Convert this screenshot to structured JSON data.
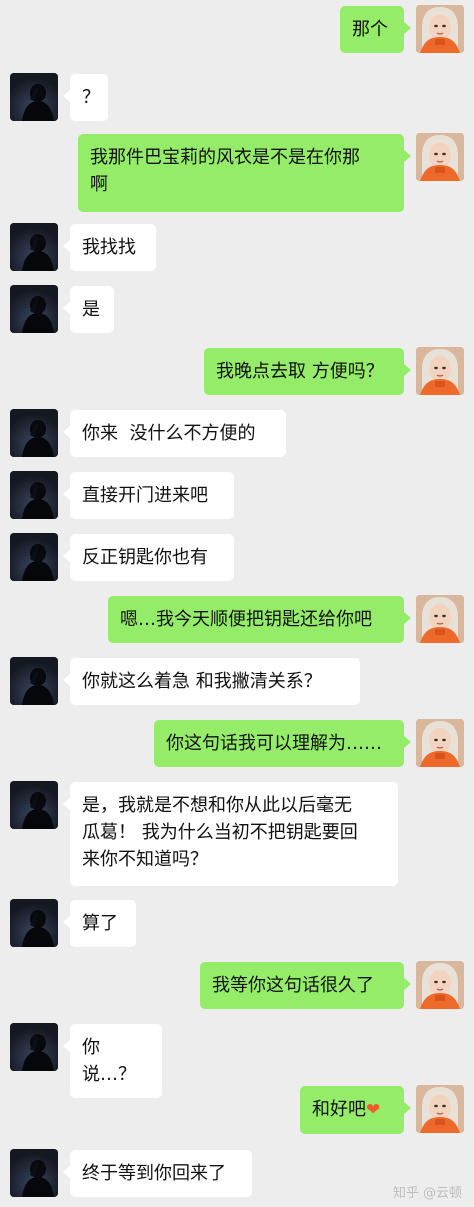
{
  "messages": [
    {
      "side": "right",
      "text": "那个"
    },
    {
      "side": "left",
      "text": "？"
    },
    {
      "side": "right",
      "text": "我那件巴宝莉的风衣是不是在你那\n啊"
    },
    {
      "side": "left",
      "text": "我找找"
    },
    {
      "side": "left",
      "text": "是"
    },
    {
      "side": "right",
      "text": "我晚点去取 方便吗？"
    },
    {
      "side": "left",
      "text": "你来  没什么不方便的"
    },
    {
      "side": "left",
      "text": "直接开门进来吧"
    },
    {
      "side": "left",
      "text": "反正钥匙你也有"
    },
    {
      "side": "right",
      "text": "嗯…我今天顺便把钥匙还给你吧"
    },
    {
      "side": "left",
      "text": "你就这么着急 和我撇清关系？"
    },
    {
      "side": "right",
      "text": "你这句话我可以理解为……"
    },
    {
      "side": "left",
      "text": "是，我就是不想和你从此以后毫无\n瓜葛！ 我为什么当初不把钥匙要回\n来你不知道吗？"
    },
    {
      "side": "left",
      "text": "算了"
    },
    {
      "side": "right",
      "text": "我等你这句话很久了"
    },
    {
      "side": "left",
      "text": "你说…？"
    },
    {
      "side": "right",
      "text": "和好吧",
      "emoji": "❤"
    },
    {
      "side": "left",
      "text": "终于等到你回来了"
    }
  ],
  "watermark": "知乎 @云顿",
  "colors": {
    "background": "#ededed",
    "sent_bubble": "#95ec69",
    "received_bubble": "#ffffff",
    "heart": "#ef5c2c"
  }
}
